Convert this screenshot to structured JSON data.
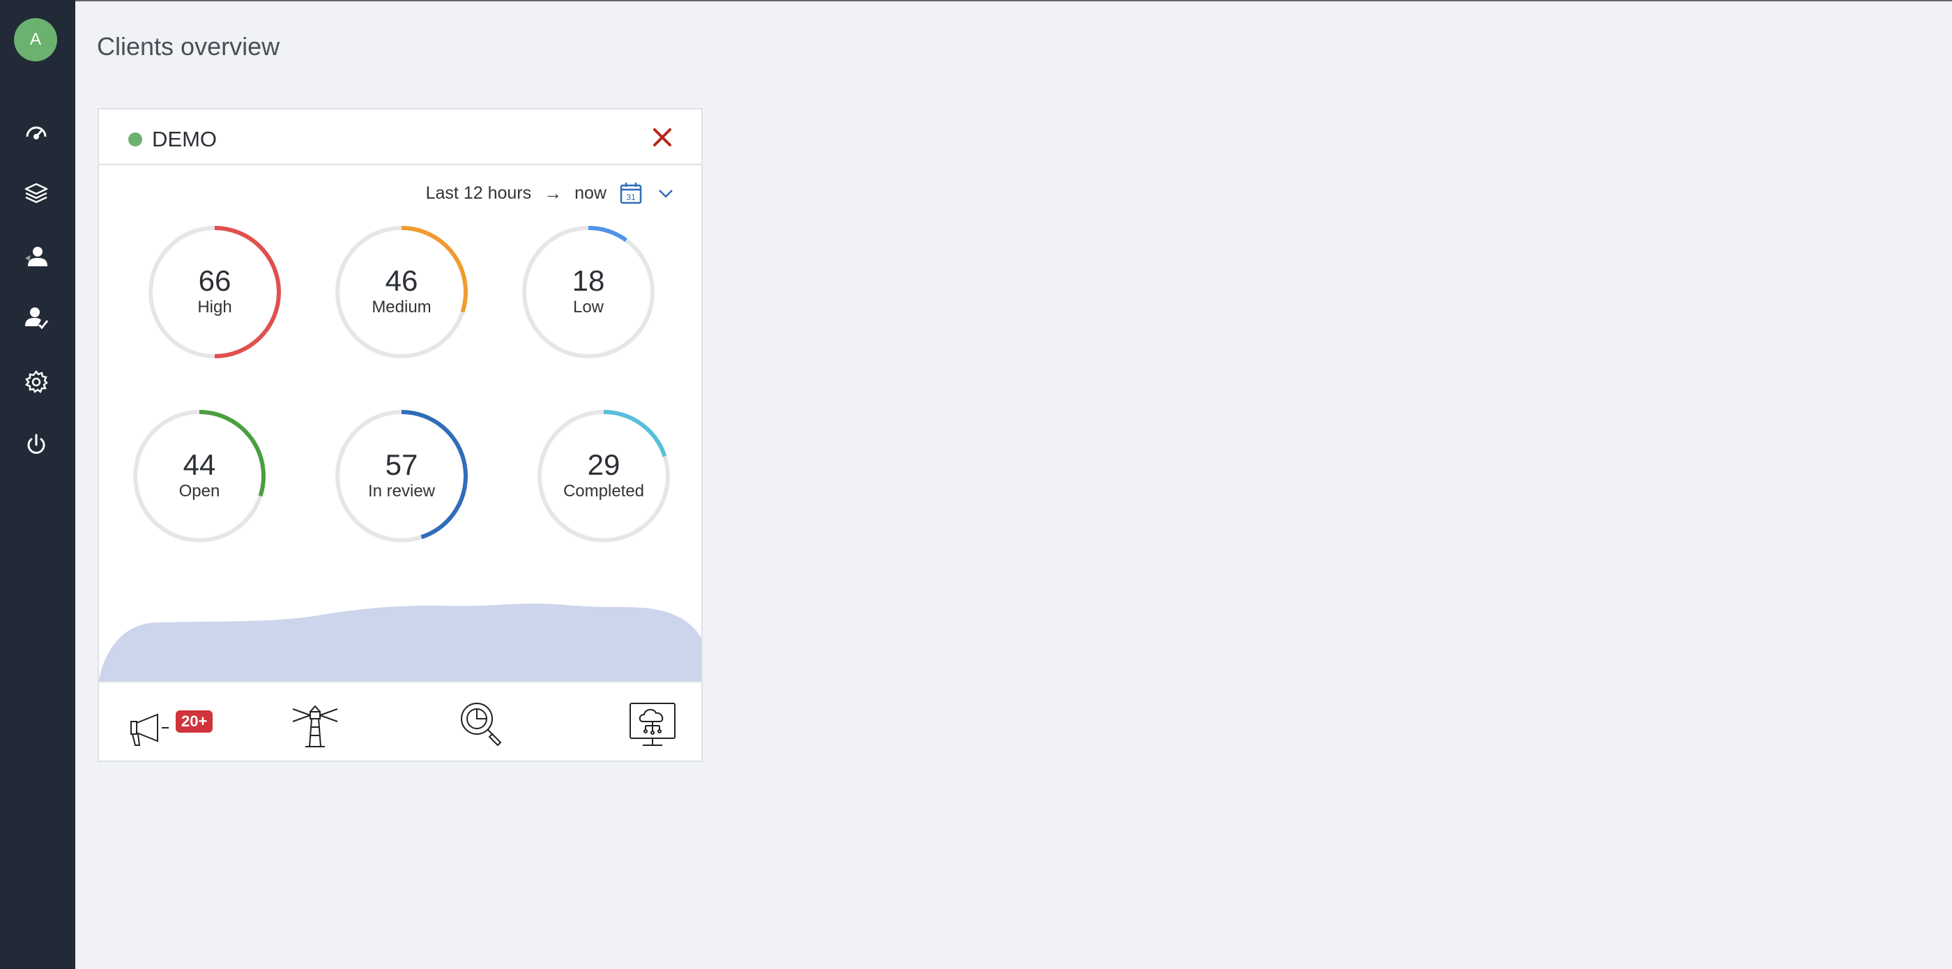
{
  "sidebar": {
    "avatar_initial": "A",
    "items": [
      {
        "name": "dashboard-icon"
      },
      {
        "name": "layers-icon"
      },
      {
        "name": "user-icon"
      },
      {
        "name": "user-check-icon"
      },
      {
        "name": "gear-icon"
      },
      {
        "name": "power-icon"
      }
    ]
  },
  "page": {
    "title": "Clients overview"
  },
  "card": {
    "name": "DEMO",
    "status_color": "#6cb26f",
    "timerange": {
      "from": "Last 12 hours",
      "arrow": "→",
      "to": "now"
    },
    "gauges": [
      {
        "value": "66",
        "label": "High",
        "color": "#e0504d",
        "fraction": 0.5
      },
      {
        "value": "46",
        "label": "Medium",
        "color": "#f09a30",
        "fraction": 0.3
      },
      {
        "value": "18",
        "label": "Low",
        "color": "#4e93e8",
        "fraction": 0.1
      },
      {
        "value": "44",
        "label": "Open",
        "color": "#4a9f3f",
        "fraction": 0.3
      },
      {
        "value": "57",
        "label": "In review",
        "color": "#2f6db8",
        "fraction": 0.45
      },
      {
        "value": "29",
        "label": "Completed",
        "color": "#56c0da",
        "fraction": 0.2
      }
    ],
    "footer": {
      "notifications_badge": "20+",
      "icons": [
        "megaphone-icon",
        "lighthouse-icon",
        "chart-search-icon",
        "cloud-network-icon"
      ]
    }
  },
  "colors": {
    "sidebar": "#212a36",
    "area_fill": "#cdd5ec",
    "close": "#b5261e"
  }
}
